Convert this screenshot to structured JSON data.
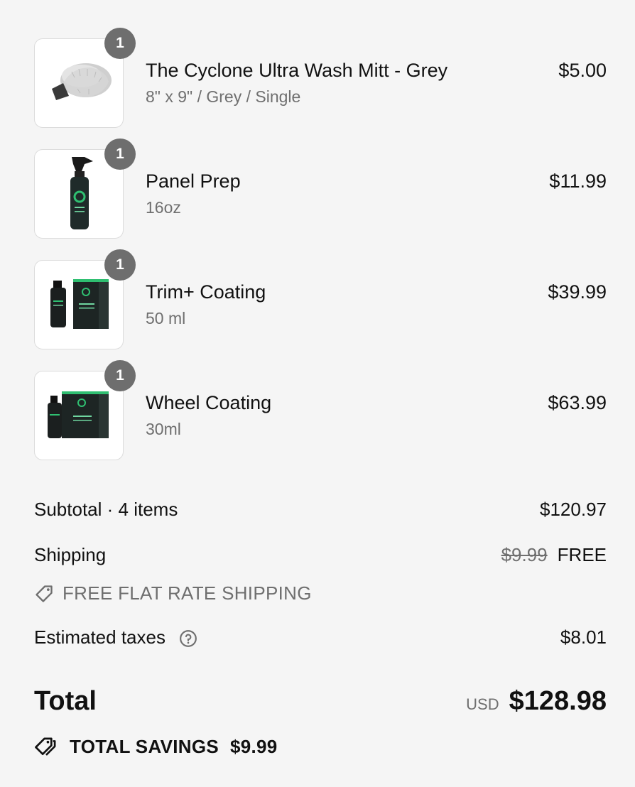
{
  "items": [
    {
      "name": "The Cyclone Ultra Wash Mitt - Grey",
      "variant": "8\" x 9\" / Grey / Single",
      "price": "$5.00",
      "qty": "1",
      "image": "wash-mitt"
    },
    {
      "name": "Panel Prep",
      "variant": "16oz",
      "price": "$11.99",
      "qty": "1",
      "image": "spray-bottle"
    },
    {
      "name": "Trim+ Coating",
      "variant": "50 ml",
      "price": "$39.99",
      "qty": "1",
      "image": "coating-box"
    },
    {
      "name": "Wheel Coating",
      "variant": "30ml",
      "price": "$63.99",
      "qty": "1",
      "image": "coating-box"
    }
  ],
  "summary": {
    "subtotal_label": "Subtotal · 4 items",
    "subtotal_value": "$120.97",
    "shipping_label": "Shipping",
    "shipping_original": "$9.99",
    "shipping_value": "FREE",
    "discount_label": "FREE FLAT RATE SHIPPING",
    "taxes_label": "Estimated taxes",
    "taxes_value": "$8.01",
    "total_label": "Total",
    "currency": "USD",
    "total_value": "$128.98",
    "savings_label": "TOTAL SAVINGS",
    "savings_value": "$9.99"
  },
  "icons": {
    "discount": "tag-icon",
    "help": "question-circle-icon",
    "savings": "tags-icon"
  },
  "colors": {
    "badge": "#6e6e6e",
    "muted": "#6f6f6f",
    "product_green": "#2fbf71"
  }
}
